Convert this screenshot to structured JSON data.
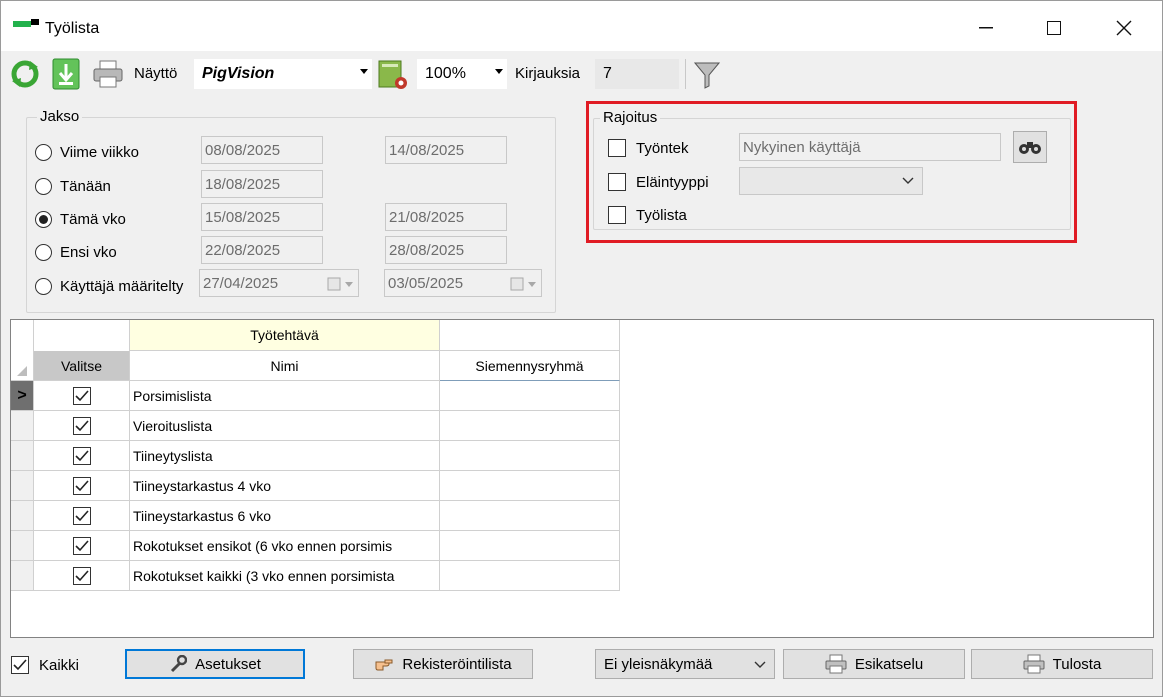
{
  "window": {
    "title": "Työlista",
    "controls": {
      "minimize": "—",
      "maximize": "☐",
      "close": "✕"
    }
  },
  "toolbar": {
    "refresh_icon": "refresh-icon",
    "download_icon": "download-icon",
    "print_icon": "printer-icon",
    "view_label": "Näyttö",
    "view_value": "PigVision",
    "view_settings_icon": "view-settings-icon",
    "zoom_value": "100%",
    "records_label": "Kirjauksia",
    "records_count": "7",
    "filter_icon": "filter-icon"
  },
  "period": {
    "legend": "Jakso",
    "options": [
      {
        "label": "Viime viikko",
        "selected": false,
        "from": "08/08/2025",
        "to": "14/08/2025"
      },
      {
        "label": "Tänään",
        "selected": false,
        "from": "18/08/2025",
        "to": ""
      },
      {
        "label": "Tämä vko",
        "selected": true,
        "from": "15/08/2025",
        "to": "21/08/2025"
      },
      {
        "label": "Ensi vko",
        "selected": false,
        "from": "22/08/2025",
        "to": "28/08/2025"
      },
      {
        "label": "Käyttäjä määritelty",
        "selected": false,
        "from": "27/04/2025",
        "to": "03/05/2025"
      }
    ]
  },
  "restriction": {
    "legend": "Rajoitus",
    "employee_label": "Työntek",
    "employee_value": "Nykyinen käyttäjä",
    "employee_lookup_icon": "binoculars-icon",
    "animal_type_label": "Eläintyyppi",
    "animal_type_value": "",
    "worklist_label": "Työlista",
    "highlight_color": "#e01b24"
  },
  "grid": {
    "band_header": "Työtehtävä",
    "columns": {
      "select": "Valitse",
      "name": "Nimi",
      "group": "Siemennysryhmä"
    },
    "current_row_marker": ">",
    "rows": [
      {
        "checked": true,
        "name": "Porsimislista",
        "group": ""
      },
      {
        "checked": true,
        "name": "Vieroituslista",
        "group": ""
      },
      {
        "checked": true,
        "name": "Tiineytyslista",
        "group": ""
      },
      {
        "checked": true,
        "name": "Tiineystarkastus 4 vko",
        "group": ""
      },
      {
        "checked": true,
        "name": "Tiineystarkastus 6 vko",
        "group": ""
      },
      {
        "checked": true,
        "name": "Rokotukset ensikot (6 vko ennen porsimis",
        "group": ""
      },
      {
        "checked": true,
        "name": "Rokotukset kaikki (3 vko ennen porsimista",
        "group": ""
      }
    ]
  },
  "footer": {
    "all_label": "Kaikki",
    "all_checked": true,
    "settings_button": "Asetukset",
    "register_button": "Rekisteröintilista",
    "general_view_value": "Ei yleisnäkymää",
    "preview_button": "Esikatselu",
    "print_button": "Tulosta"
  }
}
